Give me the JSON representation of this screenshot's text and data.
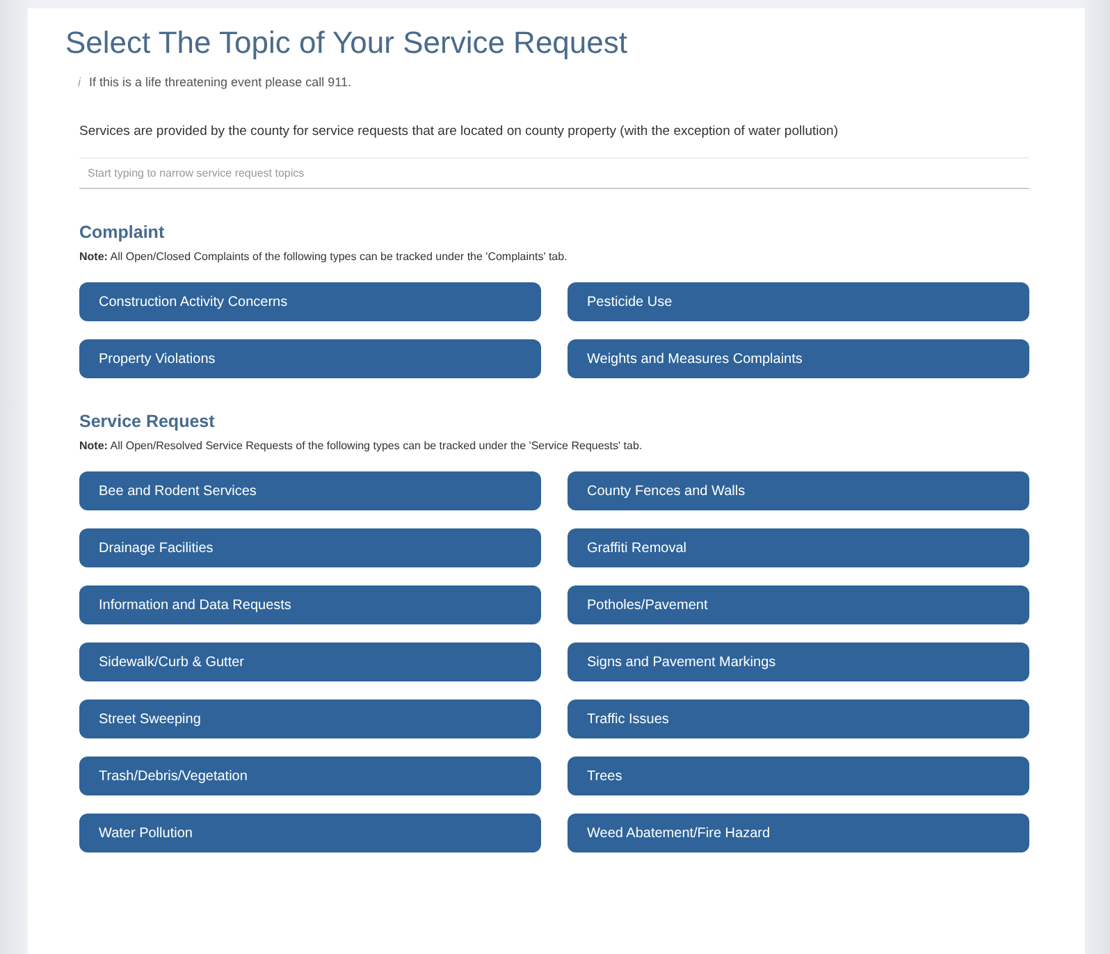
{
  "title": "Select The Topic of Your Service Request",
  "info": {
    "icon": "i",
    "text": "If this is a life threatening event please call 911."
  },
  "notice": "Services are provided by the county for service requests that are located on county property (with the exception of water pollution)",
  "search": {
    "placeholder": "Start typing to narrow service request topics"
  },
  "sections": [
    {
      "heading": "Complaint",
      "note": "**Note:** All Open/Closed Complaints of the following types can be tracked under the 'Complaints' tab.",
      "topics": [
        "Construction Activity Concerns",
        "Pesticide Use",
        "Property Violations",
        "Weights and Measures Complaints"
      ]
    },
    {
      "heading": "Service Request",
      "note": "**Note:** All Open/Resolved Service Requests of the following types can be tracked under the 'Service Requests' tab.",
      "topics": [
        "Bee and Rodent Services",
        "County Fences and Walls",
        "Drainage Facilities",
        "Graffiti Removal",
        "Information and Data Requests",
        "Potholes/Pavement",
        "Sidewalk/Curb & Gutter",
        "Signs and Pavement Markings",
        "Street Sweeping",
        "Traffic Issues",
        "Trash/Debris/Vegetation",
        "Trees",
        "Water Pollution",
        "Weed Abatement/Fire Hazard"
      ]
    }
  ]
}
